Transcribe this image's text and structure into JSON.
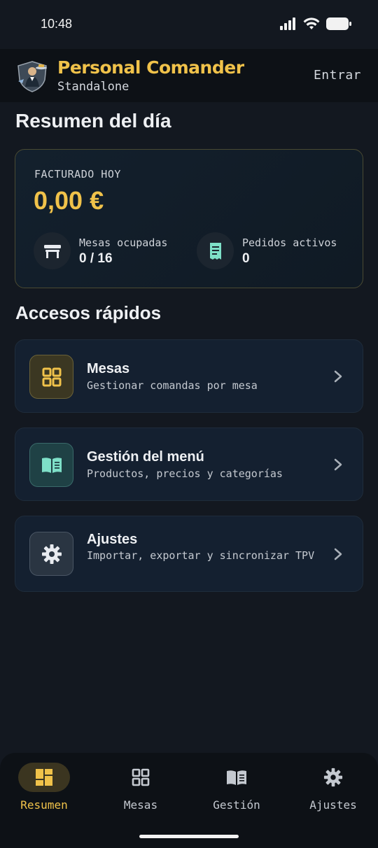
{
  "status_bar": {
    "time": "10:48"
  },
  "header": {
    "app_title": "Personal Comander",
    "app_subtitle": "Standalone",
    "login_label": "Entrar",
    "logo_icon": "waiter-logo-icon"
  },
  "summary": {
    "section_title": "Resumen del día",
    "billed_label": "FACTURADO HOY",
    "billed_amount": "0,00 €",
    "tables_label": "Mesas ocupadas",
    "tables_value": "0 / 16",
    "tables_icon": "table-icon",
    "orders_label": "Pedidos activos",
    "orders_value": "0",
    "orders_icon": "receipt-icon"
  },
  "quick_access": {
    "section_title": "Accesos rápidos",
    "items": [
      {
        "title": "Mesas",
        "subtitle": "Gestionar comandas por mesa",
        "icon": "grid-icon",
        "accent": "#f0c24a"
      },
      {
        "title": "Gestión del menú",
        "subtitle": "Productos, precios y categorías",
        "icon": "menu-book-icon",
        "accent": "#7ee0c8"
      },
      {
        "title": "Ajustes",
        "subtitle": "Importar, exportar y sincronizar TPV",
        "icon": "gear-icon",
        "accent": "#e8ebf0"
      }
    ]
  },
  "bottom_nav": {
    "items": [
      {
        "label": "Resumen",
        "icon": "dashboard-icon",
        "active": true
      },
      {
        "label": "Mesas",
        "icon": "grid-icon",
        "active": false
      },
      {
        "label": "Gestión",
        "icon": "menu-book-icon",
        "active": false
      },
      {
        "label": "Ajustes",
        "icon": "gear-icon",
        "active": false
      }
    ]
  },
  "colors": {
    "background": "#131820",
    "accent_gold": "#f0c24a",
    "accent_teal": "#7ee0c8",
    "card": "#142030"
  }
}
